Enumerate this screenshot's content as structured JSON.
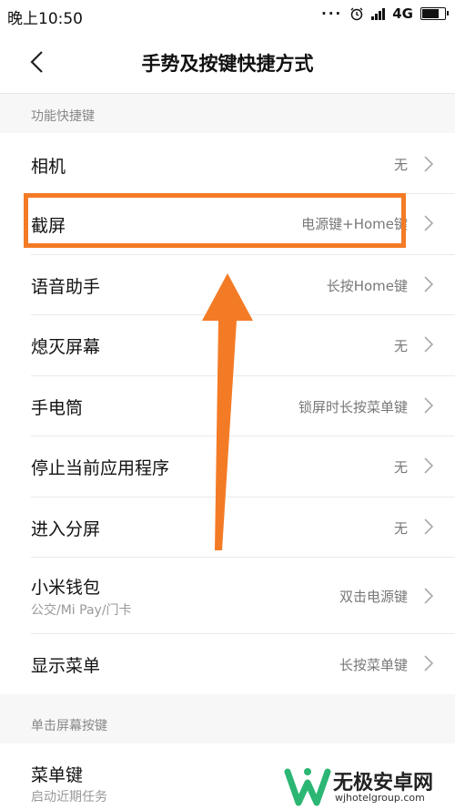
{
  "statusbar": {
    "time": "晚上10:50",
    "network": "4G",
    "dots": "···"
  },
  "header": {
    "title": "手势及按键快捷方式"
  },
  "sections": [
    {
      "title": "功能快捷键"
    },
    {
      "title": "单击屏幕按键"
    }
  ],
  "rows": [
    {
      "label": "相机",
      "value": "无"
    },
    {
      "label": "截屏",
      "value": "电源键+Home键"
    },
    {
      "label": "语音助手",
      "value": "长按Home键"
    },
    {
      "label": "熄灭屏幕",
      "value": "无"
    },
    {
      "label": "手电筒",
      "value": "锁屏时长按菜单键"
    },
    {
      "label": "停止当前应用程序",
      "value": "无"
    },
    {
      "label": "进入分屏",
      "value": "无"
    },
    {
      "label": "小米钱包",
      "sub": "公交/Mi Pay/门卡",
      "value": "双击电源键"
    },
    {
      "label": "显示菜单",
      "value": "长按菜单键"
    },
    {
      "label": "菜单键",
      "sub": "启动近期任务"
    }
  ],
  "annotation": {
    "color": "#f47b26"
  },
  "watermark": {
    "name": "无极安卓网",
    "url": "wjhotelgroup.com",
    "logo_color": "#2bb673"
  }
}
